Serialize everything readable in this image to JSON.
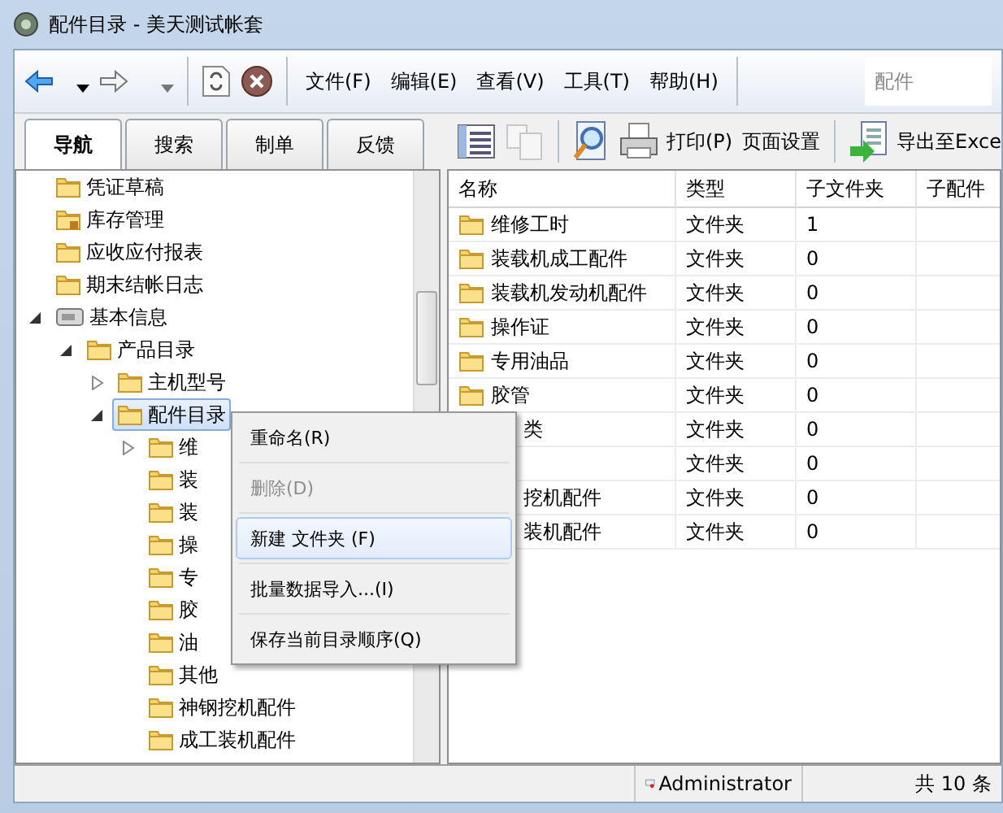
{
  "window": {
    "title": "配件目录 - 美天测试帐套"
  },
  "menu": [
    {
      "label": "文件(F)"
    },
    {
      "label": "编辑(E)"
    },
    {
      "label": "查看(V)"
    },
    {
      "label": "工具(T)"
    },
    {
      "label": "帮助(H)"
    }
  ],
  "search": {
    "placeholder": "配件"
  },
  "tabs": [
    {
      "label": "导航",
      "selected": true
    },
    {
      "label": "搜索",
      "selected": false
    },
    {
      "label": "制单",
      "selected": false
    },
    {
      "label": "反馈",
      "selected": false
    }
  ],
  "toolbar": [
    {
      "kind": "list",
      "disabled": false
    },
    {
      "kind": "copy",
      "disabled": true
    },
    {
      "kind": "sep"
    },
    {
      "kind": "preview",
      "disabled": false
    },
    {
      "kind": "print",
      "label": "打印(P)",
      "disabled": false
    },
    {
      "kind": "text",
      "label": "页面设置",
      "disabled": false
    },
    {
      "kind": "sep"
    },
    {
      "kind": "export",
      "label": "导出至Exce",
      "disabled": false
    }
  ],
  "tree": [
    {
      "label": "凭证草稿",
      "kind": "folder",
      "selected": false
    },
    {
      "label": "库存管理",
      "kind": "locked",
      "selected": false
    },
    {
      "label": "应收应付报表",
      "kind": "folder",
      "selected": false
    },
    {
      "label": "期末结帐日志",
      "kind": "folder",
      "selected": false
    },
    {
      "label": "基本信息",
      "kind": "card",
      "selected": false,
      "expanded": true,
      "children": [
        {
          "label": "产品目录",
          "kind": "folder",
          "selected": false,
          "expanded": true,
          "children": [
            {
              "label": "主机型号",
              "kind": "folder",
              "selected": false,
              "expanded": false
            },
            {
              "label": "配件目录",
              "kind": "folder",
              "selected": true,
              "expanded": true,
              "children": [
                {
                  "label": "维",
                  "kind": "folder",
                  "selected": false,
                  "expanded": false
                },
                {
                  "label": "装",
                  "kind": "folder",
                  "selected": false
                },
                {
                  "label": "装",
                  "kind": "folder",
                  "selected": false
                },
                {
                  "label": "操",
                  "kind": "folder",
                  "selected": false
                },
                {
                  "label": "专",
                  "kind": "folder",
                  "selected": false
                },
                {
                  "label": "胶",
                  "kind": "folder",
                  "selected": false
                },
                {
                  "label": "油",
                  "kind": "folder",
                  "selected": false
                },
                {
                  "label": "其他",
                  "kind": "folder",
                  "selected": false
                },
                {
                  "label": "神钢挖机配件",
                  "kind": "folder",
                  "selected": false
                },
                {
                  "label": "成工装机配件",
                  "kind": "folder",
                  "selected": false
                }
              ]
            }
          ]
        }
      ]
    }
  ],
  "table": {
    "columns": [
      "名称",
      "类型",
      "子文件夹",
      "子配件"
    ],
    "rows": [
      {
        "name": "维修工时",
        "type": "文件夹",
        "subfolders": "1",
        "kind": "folder"
      },
      {
        "name": "装载机成工配件",
        "type": "文件夹",
        "subfolders": "0",
        "kind": "folder"
      },
      {
        "name": "装载机发动机配件",
        "type": "文件夹",
        "subfolders": "0",
        "kind": "folder"
      },
      {
        "name": "操作证",
        "type": "文件夹",
        "subfolders": "0",
        "kind": "folder"
      },
      {
        "name": "专用油品",
        "type": "文件夹",
        "subfolders": "0",
        "kind": "folder"
      },
      {
        "name": "胶管",
        "type": "文件夹",
        "subfolders": "0",
        "kind": "folder"
      },
      {
        "name": "类",
        "type": "文件夹",
        "subfolders": "0",
        "kind": "covered"
      },
      {
        "type": "文件夹",
        "subfolders": "0",
        "kind": "covered"
      },
      {
        "name": "挖机配件",
        "type": "文件夹",
        "subfolders": "0",
        "kind": "covered"
      },
      {
        "name": "装机配件",
        "type": "文件夹",
        "subfolders": "0",
        "kind": "covered"
      }
    ]
  },
  "context_menu": [
    {
      "label": "重命名(R)",
      "disabled": false,
      "selected": false
    },
    {
      "label": "删除(D)",
      "disabled": true,
      "selected": false
    },
    {
      "label": "新建 文件夹 (F)",
      "disabled": false,
      "selected": true
    },
    {
      "label": "批量数据导入...(I)",
      "disabled": false,
      "selected": false
    },
    {
      "label": "保存当前目录顺序(Q)",
      "disabled": false,
      "selected": false
    }
  ],
  "status_bar": {
    "user": "Administrator",
    "count": "共 10 条"
  }
}
